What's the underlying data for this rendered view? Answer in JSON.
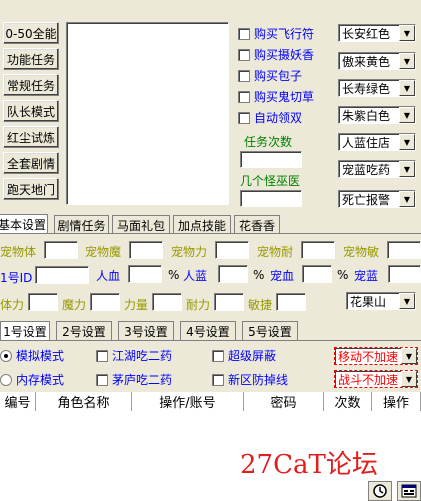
{
  "left_buttons": [
    "0-50全能",
    "功能任务",
    "常规任务",
    "队长模式",
    "红尘试炼",
    "全套剧情",
    "跑天地门"
  ],
  "purchase_checks": [
    "购买飞行符",
    "购买摄妖香",
    "购买包子",
    "购买鬼切草",
    "自动领双"
  ],
  "task_count_label": "任务次数",
  "boss_label": "几个怪巫医",
  "right_dropdowns": [
    "长安红色",
    "傲来黄色",
    "长寿绿色",
    "朱紫白色",
    "人蓝住店",
    "宠蓝吃药",
    "死亡报警"
  ],
  "tabs": [
    "基本设置",
    "剧情任务",
    "马面礼包",
    "加点技能",
    "花香香"
  ],
  "pet_attrs": [
    "宠物体",
    "宠物魔",
    "宠物力",
    "宠物耐",
    "宠物敏"
  ],
  "row2": {
    "id_label": "1号ID",
    "hp": "人血",
    "mp": "人蓝",
    "pet_hp": "宠血",
    "pet_mp": "宠蓝",
    "percent": "%"
  },
  "row3": [
    "体力",
    "魔力",
    "力量",
    "耐力",
    "敏捷"
  ],
  "row3_dropdown": "花果山",
  "account_tabs": [
    "1号设置",
    "2号设置",
    "3号设置",
    "4号设置",
    "5号设置"
  ],
  "mode_options": {
    "radio1": "模拟模式",
    "radio2": "内存模式"
  },
  "opt_checks": [
    "江湖吃二药",
    "茅庐吃二药",
    "超级屏蔽",
    "新区防掉线"
  ],
  "speed_dropdowns": [
    "移动不加速",
    "战斗不加速"
  ],
  "table_headers": [
    "编号",
    "角色名称",
    "操作/账号",
    "密码",
    "次数",
    "操作"
  ],
  "watermark": "27CaT论坛",
  "colors": {
    "blue": "#0000ff",
    "green": "#008000",
    "olive": "#999900",
    "red": "#ff0000"
  }
}
